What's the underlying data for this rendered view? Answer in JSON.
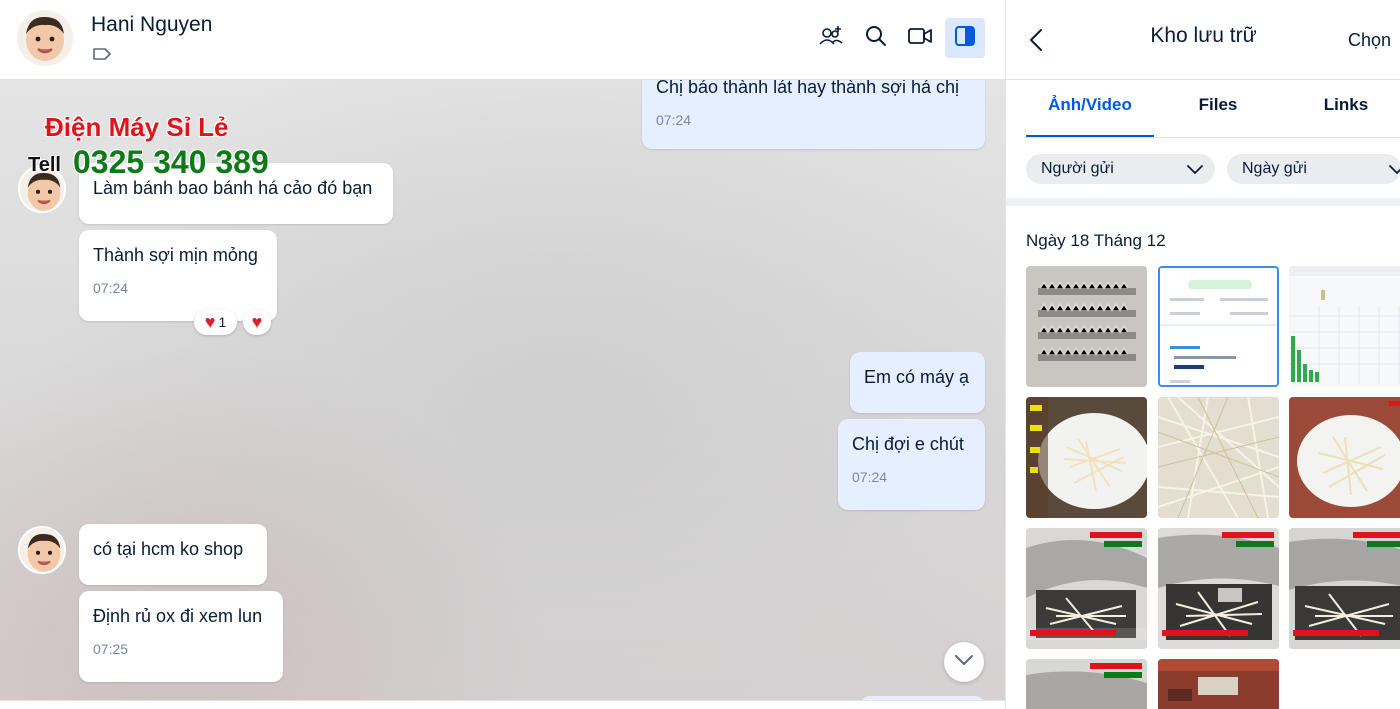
{
  "chat": {
    "contact_name": "Hani Nguyen",
    "header_icons": [
      "group-add-icon",
      "search-icon",
      "video-call-icon",
      "panel-toggle-icon"
    ],
    "watermark": {
      "name": "Điện Máy Sỉ Lẻ",
      "tell": "Tell",
      "phone": "0325 340 389"
    },
    "messages": [
      {
        "side": "out",
        "text": "Chị bảo thành lát hay thành sợi há chị",
        "time": "07:24"
      },
      {
        "side": "in",
        "text": "Làm bánh bao bánh há cảo đó bạn",
        "time": ""
      },
      {
        "side": "in",
        "text": "Thành sợi mịn mỏng",
        "time": "07:24",
        "reaction_count": "1"
      },
      {
        "side": "out",
        "text": "Em có máy ạ",
        "time": ""
      },
      {
        "side": "out",
        "text": "Chị đợi e chút",
        "time": "07:24"
      },
      {
        "side": "in",
        "text": "có tại hcm ko shop",
        "time": ""
      },
      {
        "side": "in",
        "text": "Định rủ ox đi xem lun",
        "time": "07:25"
      }
    ]
  },
  "storage": {
    "title": "Kho lưu trữ",
    "select_label": "Chọn",
    "tabs": [
      {
        "label": "Ảnh/Video",
        "active": true
      },
      {
        "label": "Files",
        "active": false
      },
      {
        "label": "Links",
        "active": false
      }
    ],
    "filters": {
      "sender": "Người gửi",
      "date": "Ngày gửi"
    },
    "date_group": "Ngày 18 Tháng 12",
    "thumbnails": [
      "metal-blades-photo",
      "transfer-receipt-screenshot",
      "bar-chart-screenshot",
      "shredded-cassava-plate-photo",
      "shredded-cassava-closeup-photo",
      "shredded-cassava-plate-photo",
      "shredding-machine-photo",
      "shredding-machine-photo",
      "shredding-machine-photo",
      "shredding-machine-photo",
      "workshop-photo"
    ]
  }
}
